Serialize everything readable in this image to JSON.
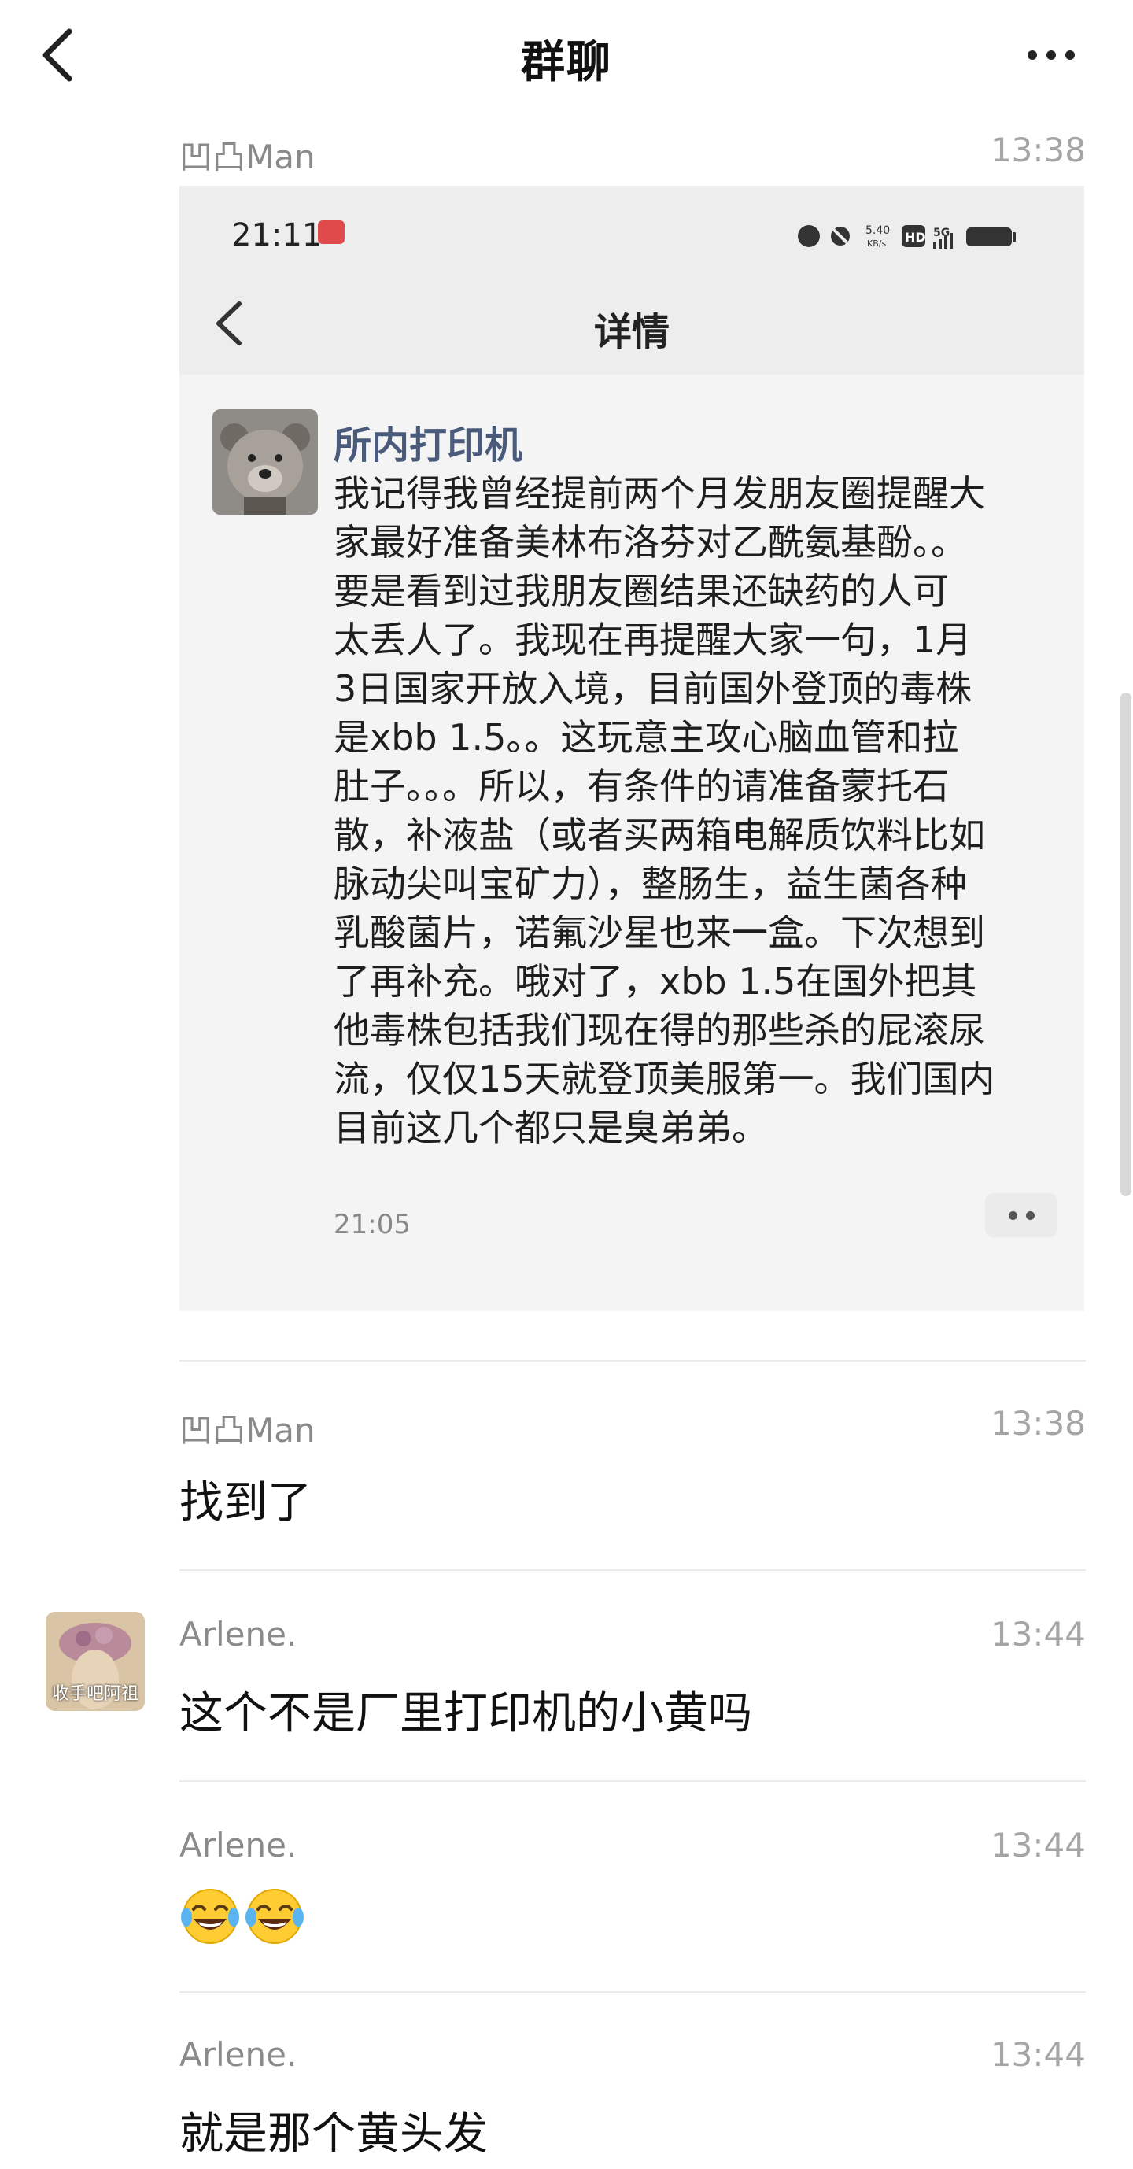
{
  "header": {
    "title": "群聊",
    "back_icon": "chevron-left-icon",
    "more_icon": "more-horizontal-icon"
  },
  "messages": [
    {
      "sender": "凹凸Man",
      "time": "13:38",
      "type": "image"
    },
    {
      "sender": "凹凸Man",
      "time": "13:38",
      "text": "找到了"
    },
    {
      "sender": "Arlene.",
      "time": "13:44",
      "text": "这个不是厂里打印机的小黄吗",
      "avatar_caption": "收手吧阿祖"
    },
    {
      "sender": "Arlene.",
      "time": "13:44",
      "emoji": "tears-of-joy-emoji",
      "emoji_count": 2
    },
    {
      "sender": "Arlene.",
      "time": "13:44",
      "text": "就是那个黄头发"
    }
  ],
  "screenshot": {
    "status_time": "21:11",
    "net_speed_value": "5.40",
    "net_speed_unit": "KB/s",
    "network_badge_1": "HD",
    "network_badge_2": "5G",
    "page_title": "详情",
    "post_author": "所内打印机",
    "post_lines": [
      "我记得我曾经提前两个月发朋友圈提醒大",
      "家最好准备美林布洛芬对乙酰氨基酚。。",
      "要是看到过我朋友圈结果还缺药的人可",
      "太丢人了。我现在再提醒大家一句，1月",
      "3日国家开放入境，目前国外登顶的毒株",
      "是xbb 1.5。。这玩意主攻心脑血管和拉",
      "肚子。。。所以，有条件的请准备蒙托石",
      "散，补液盐（或者买两箱电解质饮料比如",
      "脉动尖叫宝矿力），整肠生，益生菌各种",
      "乳酸菌片，诺氟沙星也来一盒。下次想到",
      "了再补充。哦对了，xbb 1.5在国外把其",
      "他毒株包括我们现在得的那些杀的屁滚尿",
      "流，仅仅15天就登顶美服第一。我们国内",
      "目前这几个都只是臭弟弟。"
    ],
    "post_time": "21:05"
  },
  "colors": {
    "text": "#111111",
    "meta": "#8a8a8a",
    "author_link": "#4a5a7a",
    "divider": "#ececec"
  }
}
